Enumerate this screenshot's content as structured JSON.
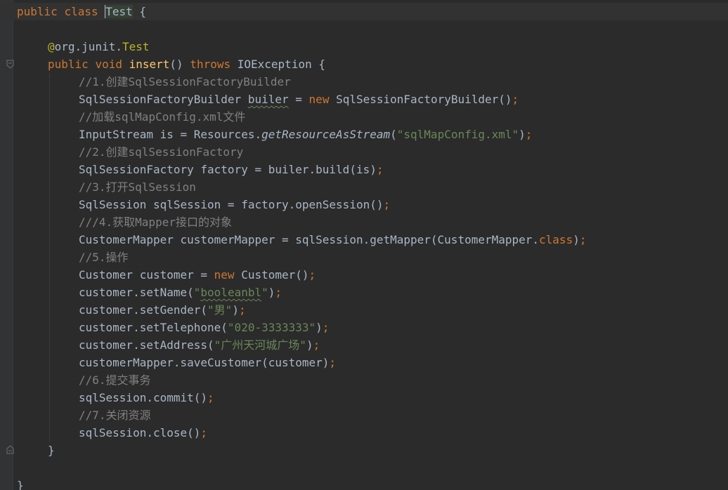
{
  "editor": {
    "colors": {
      "background": "#2b2b2b",
      "gutter": "#313335",
      "keyword": "#cc7832",
      "annotation": "#bbb529",
      "method_decl": "#ffc66d",
      "string": "#6a8759",
      "comment": "#808080",
      "plain": "#a9b7c6"
    },
    "icons": [
      "fold-open-icon",
      "fold-end-icon"
    ],
    "code": {
      "l1": {
        "kw1": "public",
        "kw2": "class",
        "name": "Test",
        "brace": "{"
      },
      "l3": {
        "at": "@",
        "pkg": "org.junit.",
        "ann": "Test"
      },
      "l4": {
        "kw1": "public",
        "kw2": "void",
        "method": "insert",
        "params": "()",
        "kw3": "throws",
        "exc": "IOException",
        "brace": "{"
      },
      "l5": {
        "comment": "//1.创建SqlSessionFactoryBuilder"
      },
      "l6": {
        "type": "SqlSessionFactoryBuilder",
        "var": "builer",
        "eq": "=",
        "kw": "new",
        "ctor": "SqlSessionFactoryBuilder()",
        "semi": ";"
      },
      "l7": {
        "comment": "//加载sqlMapConfig.xml文件"
      },
      "l8": {
        "lhs": "InputStream is = Resources.",
        "method": "getResourceAsStream",
        "open": "(",
        "str": "\"sqlMapConfig.xml\"",
        "close": ")",
        "semi": ";"
      },
      "l9": {
        "comment": "//2.创建sqlSessionFactory"
      },
      "l10": {
        "text": "SqlSessionFactory factory = builer.build(is)",
        "semi": ";"
      },
      "l11": {
        "comment": "//3.打开SqlSession"
      },
      "l12": {
        "text": "SqlSession sqlSession = factory.openSession()",
        "semi": ";"
      },
      "l13": {
        "comment": "///4.获取Mapper接口的对象"
      },
      "l14": {
        "text": "CustomerMapper customerMapper = sqlSession.getMapper(CustomerMapper.",
        "kw": "class",
        "close": ")",
        "semi": ";"
      },
      "l15": {
        "comment": "//5.操作"
      },
      "l16": {
        "lhs": "Customer customer = ",
        "kw": "new",
        "ctor": " Customer()",
        "semi": ";"
      },
      "l17": {
        "call": "customer.setName(",
        "q1": "\"",
        "str": "booleanbl",
        "q2": "\"",
        "close": ")",
        "semi": ";"
      },
      "l18": {
        "call": "customer.setGender(",
        "str": "\"男\"",
        "close": ")",
        "semi": ";"
      },
      "l19": {
        "call": "customer.setTelephone(",
        "str": "\"020-3333333\"",
        "close": ")",
        "semi": ";"
      },
      "l20": {
        "call": "customer.setAddress(",
        "str": "\"广州天河城广场\"",
        "close": ")",
        "semi": ";"
      },
      "l21": {
        "text": "customerMapper.saveCustomer(customer)",
        "semi": ";"
      },
      "l22": {
        "comment": "//6.提交事务"
      },
      "l23": {
        "text": "sqlSession.commit()",
        "semi": ";"
      },
      "l24": {
        "comment": "//7.关闭资源"
      },
      "l25": {
        "text": "sqlSession.close()",
        "semi": ";"
      },
      "l26": {
        "brace": "}"
      },
      "l28": {
        "brace": "}"
      }
    }
  }
}
